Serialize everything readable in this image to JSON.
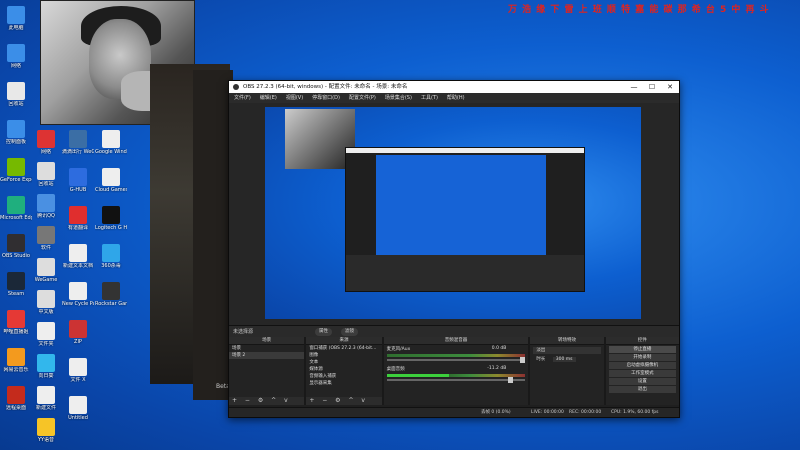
{
  "desktop": {
    "top_text": "万 浩 缘 下 雷   上 班 顺 特 嘉   能 碳 那 希 台   5 中 再 斗",
    "icons": [
      {
        "label": "此电脑",
        "color": "#3b8ee8"
      },
      {
        "label": "网络",
        "color": "#3b8ee8"
      },
      {
        "label": "回收站",
        "color": "#e8e8e8"
      },
      {
        "label": "控制面板",
        "color": "#3b8ee8"
      },
      {
        "label": "GeForce Experience",
        "color": "#76b900"
      },
      {
        "label": "Microsoft Edge",
        "color": "#1faf7e"
      },
      {
        "label": "OBS Studio",
        "color": "#302e31"
      },
      {
        "label": "Steam",
        "color": "#1b2838"
      },
      {
        "label": "哔哩直播姬",
        "color": "#e53935"
      },
      {
        "label": "网易云音乐",
        "color": "#f39a1e"
      },
      {
        "label": "远程桌面",
        "color": "#c42b1c"
      }
    ],
    "col2_icons": [
      {
        "label": "网络",
        "color": "#d33"
      },
      {
        "label": "回收站",
        "color": "#ddd"
      },
      {
        "label": "腾讯QQ",
        "color": "#4a90e2"
      },
      {
        "label": "软件",
        "color": "#777"
      },
      {
        "label": "WeGame",
        "color": "#ddd"
      },
      {
        "label": "中文版",
        "color": "#ddd"
      },
      {
        "label": "文件夹",
        "color": "#eee"
      },
      {
        "label": "向日葵",
        "color": "#32b7ec"
      },
      {
        "label": "新建文件",
        "color": "#eee"
      },
      {
        "label": "YY语音",
        "color": "#f6c427"
      }
    ],
    "col3_icons": [
      {
        "label": "滴滴出行 WeGame",
        "color": "#3b6ea5"
      },
      {
        "label": "G-HUB",
        "color": "#2d6cdf"
      },
      {
        "label": "有道翻译",
        "color": "#e02e2e"
      },
      {
        "label": "新建文本文档",
        "color": "#eee"
      },
      {
        "label": "New Cycle Payment",
        "color": "#eee"
      },
      {
        "label": "ZIP",
        "color": "#c33"
      },
      {
        "label": "文件 X",
        "color": "#eee"
      },
      {
        "label": "Untitled",
        "color": "#eee"
      }
    ],
    "col4_icons": [
      {
        "label": "Google Windows",
        "color": "#eee"
      },
      {
        "label": "Cloud Games",
        "color": "#eee"
      },
      {
        "label": "Logitech G HUB",
        "color": "#111"
      },
      {
        "label": "360杀毒",
        "color": "#2fa6e9"
      },
      {
        "label": "Rockstar Games",
        "color": "#333"
      }
    ]
  },
  "obs": {
    "title": "OBS 27.2.3 (64-bit, windows) - 配置文件: 未命名 - 场景: 未命名",
    "window_buttons": [
      "—",
      "☐",
      "✕"
    ],
    "menu": [
      "文件(F)",
      "编辑(E)",
      "视图(V)",
      "停靠窗口(D)",
      "配置文件(P)",
      "场景集合(S)",
      "工具(T)",
      "帮助(H)"
    ],
    "game_label": "Beta",
    "scenebar": {
      "title": "未选择源",
      "props_label": "属性",
      "filters_label": "滤镜"
    },
    "scenes": {
      "header": "场景",
      "items": [
        "场景",
        "场景 2"
      ]
    },
    "sources": {
      "header": "来源",
      "items": [
        "窗口捕获 (OBS 27.2.3 (64-bit...",
        "图像",
        "文本",
        "媒体源",
        "音频输入捕获",
        "显示器采集"
      ]
    },
    "mixer": {
      "header": "音频混音器",
      "tracks": [
        {
          "name": "麦克风/Aux",
          "db": "0.0 dB"
        },
        {
          "name": "桌面音频",
          "db": "-11.2 dB"
        }
      ]
    },
    "transitions": {
      "header": "转场特效",
      "type": "淡出",
      "duration_label": "时长",
      "duration": "300 ms"
    },
    "controls": {
      "header": "控件",
      "buttons": [
        "停止直播",
        "开始录制",
        "启动虚拟摄像机",
        "工作室模式",
        "设置",
        "退出"
      ]
    },
    "status": {
      "dropped": "丢帧 0 (0.0%)",
      "live": "LIVE: 00:00:00",
      "rec": "REC: 00:00:00",
      "cpu": "CPU: 1.9%, 60.00 fps"
    },
    "tool_glyphs": "+ − ⚙ ^ v"
  }
}
